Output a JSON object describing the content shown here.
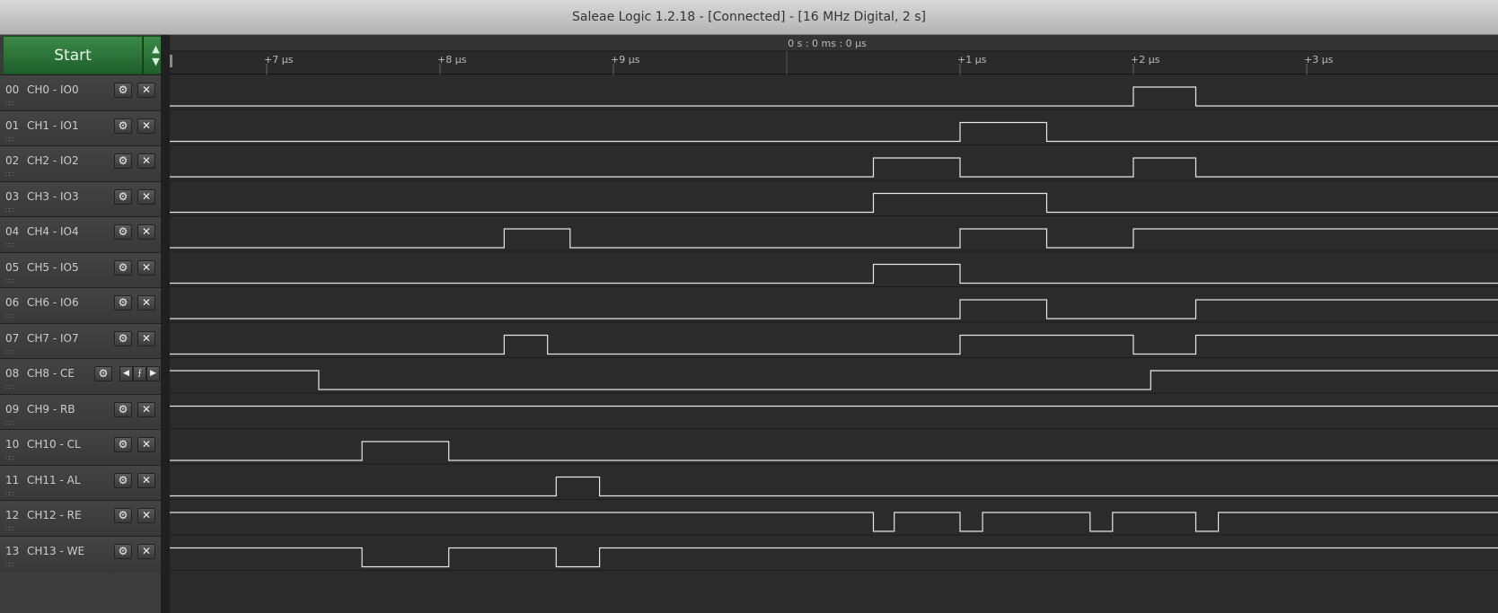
{
  "window": {
    "title": "Saleae Logic 1.2.18 - [Connected] - [16 MHz Digital, 2 s]"
  },
  "controls": {
    "start_label": "Start",
    "up_icon": "triangle-up-icon",
    "down_icon": "triangle-down-icon"
  },
  "timeline": {
    "origin_label": "0 s : 0 ms : 0 μs",
    "ticks": [
      {
        "label": "+7 μs",
        "t": -3
      },
      {
        "label": "+8 μs",
        "t": -2
      },
      {
        "label": "+9 μs",
        "t": -1
      },
      {
        "label": "+1 μs",
        "t": 1
      },
      {
        "label": "+2 μs",
        "t": 2
      },
      {
        "label": "+3 μs",
        "t": 3
      }
    ]
  },
  "channels": [
    {
      "num": "00",
      "name": "CH0 - IO0",
      "color": "#404040",
      "trigger": false,
      "initial": 0,
      "edges": [
        2.0,
        2.36
      ]
    },
    {
      "num": "01",
      "name": "CH1 - IO1",
      "color": "#8b5a2b",
      "trigger": false,
      "initial": 0,
      "edges": [
        1.0,
        1.5
      ]
    },
    {
      "num": "02",
      "name": "CH2 - IO2",
      "color": "#d02020",
      "trigger": false,
      "initial": 0,
      "edges": [
        0.5,
        1.0,
        2.0,
        2.36
      ]
    },
    {
      "num": "03",
      "name": "CH3 - IO3",
      "color": "#e08a20",
      "trigger": false,
      "initial": 0,
      "edges": [
        0.5,
        1.5
      ]
    },
    {
      "num": "04",
      "name": "CH4 - IO4",
      "color": "#e0d020",
      "trigger": false,
      "initial": 0,
      "edges": [
        -1.63,
        -1.25,
        1.0,
        1.5,
        2.0
      ]
    },
    {
      "num": "05",
      "name": "CH5 - IO5",
      "color": "#3aa035",
      "trigger": false,
      "initial": 0,
      "edges": [
        0.5,
        1.0
      ]
    },
    {
      "num": "06",
      "name": "CH6 - IO6",
      "color": "#3050d0",
      "trigger": false,
      "initial": 0,
      "edges": [
        1.0,
        1.5,
        2.36
      ]
    },
    {
      "num": "07",
      "name": "CH7 - IO7",
      "color": "#9040d0",
      "trigger": false,
      "initial": 0,
      "edges": [
        -1.63,
        -1.38,
        1.0,
        2.0,
        2.36
      ]
    },
    {
      "num": "08",
      "name": "CH8 - CE",
      "color": "#808080",
      "trigger": true,
      "initial": 1,
      "edges": [
        -2.7,
        2.1
      ]
    },
    {
      "num": "09",
      "name": "CH9 - RB",
      "color": "#8b5a2b",
      "trigger": false,
      "initial": 1,
      "edges": []
    },
    {
      "num": "10",
      "name": "CH10 - CL",
      "color": "#d02020",
      "trigger": false,
      "initial": 0,
      "edges": [
        -2.45,
        -1.95
      ]
    },
    {
      "num": "11",
      "name": "CH11 - AL",
      "color": "#e08a20",
      "trigger": false,
      "initial": 0,
      "edges": [
        -1.33,
        -1.08
      ]
    },
    {
      "num": "12",
      "name": "CH12 - RE",
      "color": "#e0d020",
      "trigger": false,
      "initial": 1,
      "edges": [
        0.5,
        0.62,
        1.0,
        1.13,
        1.75,
        1.88,
        2.36,
        2.49
      ]
    },
    {
      "num": "13",
      "name": "CH13 - WE",
      "color": "#3aa035",
      "trigger": false,
      "initial": 1,
      "edges": [
        -2.45,
        -1.95,
        -1.33,
        -1.08
      ]
    }
  ]
}
